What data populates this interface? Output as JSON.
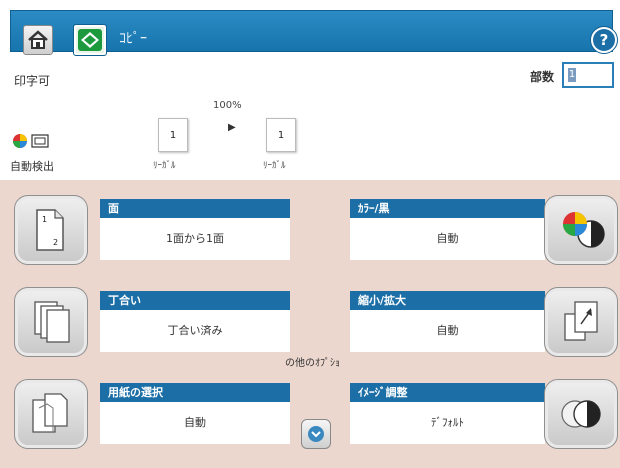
{
  "topbar": {
    "title": "ｺﾋﾟｰ",
    "home_icon": "home-icon",
    "copy_icon": "copy-start-icon",
    "help_icon": "help-icon"
  },
  "status": {
    "message": "印字可",
    "copies_label": "部数",
    "copies_value": "1"
  },
  "preview": {
    "zoom": "100%",
    "source_count": "1",
    "dest_count": "1",
    "source_paper": "ﾘｰｶﾞﾙ",
    "dest_paper": "ﾘｰｶﾞﾙ",
    "color_mode_label": "自動検出"
  },
  "tiles": {
    "sides": {
      "label": "面",
      "value": "1面から1面"
    },
    "collate": {
      "label": "丁合い",
      "value": "丁合い済み"
    },
    "paper": {
      "label": "用紙の選択",
      "value": "自動"
    },
    "color": {
      "label": "ｶﾗｰ/黒",
      "value": "自動"
    },
    "reduce": {
      "label": "縮小/拡大",
      "value": "自動"
    },
    "image": {
      "label": "ｲﾒｰｼﾞ調整",
      "value": "ﾃﾞﾌｫﾙﾄ"
    }
  },
  "other_options": "の他のｵﾌﾟｼｮ",
  "colors": {
    "topbar": "#1774ad",
    "tile_header": "#1c6ea6",
    "panel_bg": "#ecd7cf"
  }
}
